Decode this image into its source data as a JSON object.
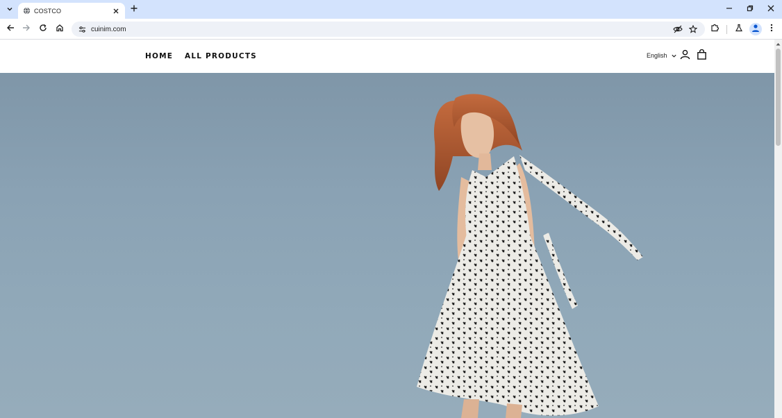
{
  "browser": {
    "tab": {
      "title": "COSTCO"
    },
    "address": {
      "url": "cuinim.com"
    },
    "icons": {
      "tab_search": "chevron-down-icon",
      "favicon": "globe-icon",
      "tab_close": "close-icon",
      "new_tab": "plus-icon",
      "back": "arrow-left-icon",
      "forward": "arrow-right-icon",
      "reload": "reload-icon",
      "home": "home-icon",
      "site_info": "tune-icon",
      "tracking": "eye-off-icon",
      "bookmark": "star-icon",
      "extensions": "puzzle-icon",
      "labs": "flask-icon",
      "profile": "person-icon",
      "menu": "kebab-icon"
    }
  },
  "site": {
    "nav": {
      "home": "HOME",
      "all_products": "ALL PRODUCTS"
    },
    "language": "English",
    "icons": {
      "account": "user-icon",
      "cart": "shopping-bag-icon"
    }
  },
  "hero": {
    "image": "woman in white patterned sundress against blue sky"
  },
  "colors": {
    "tabstrip": "#d3e3fd",
    "sky": "#8aa2b4",
    "nav_text": "#111111"
  }
}
